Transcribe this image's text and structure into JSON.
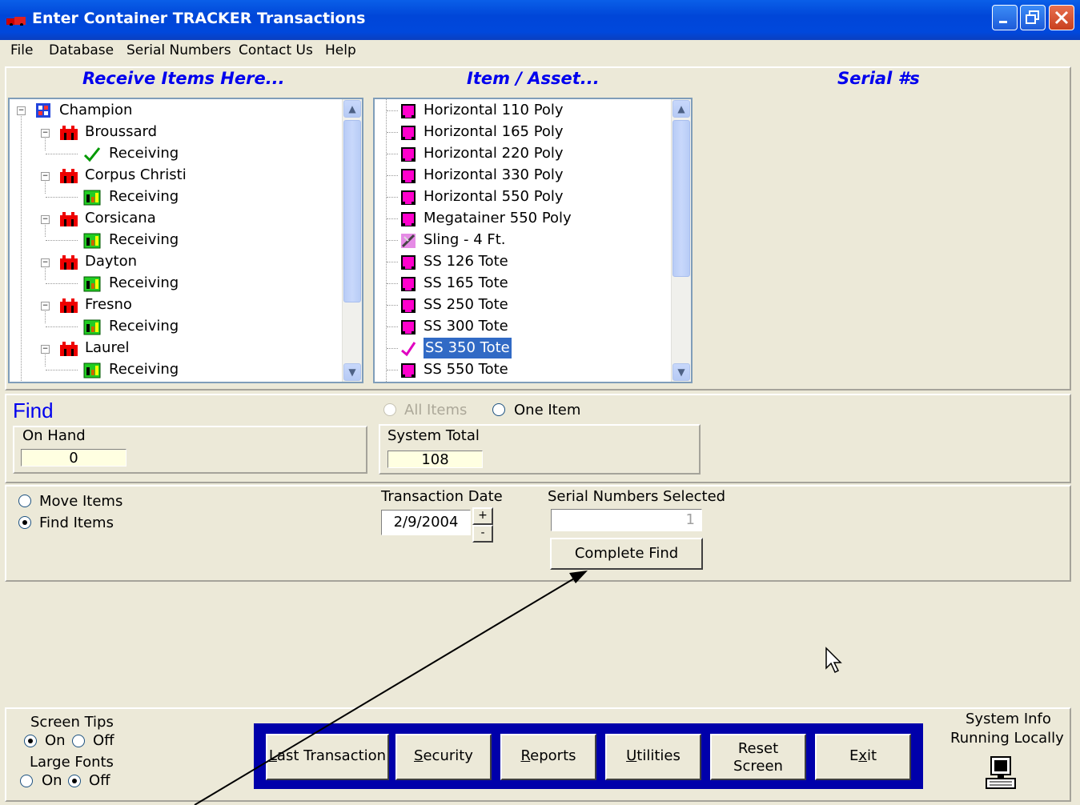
{
  "window": {
    "title": "Enter Container TRACKER Transactions"
  },
  "menu": [
    "File",
    "Database",
    "Serial Numbers",
    "Contact Us",
    "Help"
  ],
  "columns": {
    "receive": "Receive Items Here...",
    "item": "Item / Asset...",
    "serial": "Serial #s"
  },
  "locations": [
    {
      "label": "Champion",
      "level": 0,
      "icon": "network-icon"
    },
    {
      "label": "Broussard",
      "level": 1,
      "icon": "factory-icon"
    },
    {
      "label": "Receiving",
      "level": 2,
      "icon": "checkmark-icon"
    },
    {
      "label": "Corpus Christi",
      "level": 1,
      "icon": "factory-icon"
    },
    {
      "label": "Receiving",
      "level": 2,
      "icon": "receiving-icon"
    },
    {
      "label": "Corsicana",
      "level": 1,
      "icon": "factory-icon"
    },
    {
      "label": "Receiving",
      "level": 2,
      "icon": "receiving-icon"
    },
    {
      "label": "Dayton",
      "level": 1,
      "icon": "factory-icon"
    },
    {
      "label": "Receiving",
      "level": 2,
      "icon": "receiving-icon"
    },
    {
      "label": "Fresno",
      "level": 1,
      "icon": "factory-icon"
    },
    {
      "label": "Receiving",
      "level": 2,
      "icon": "receiving-icon"
    },
    {
      "label": "Laurel",
      "level": 1,
      "icon": "factory-icon"
    },
    {
      "label": "Receiving",
      "level": 2,
      "icon": "receiving-icon"
    }
  ],
  "items": [
    {
      "label": "Horizontal 110 Poly",
      "icon": "tote-icon"
    },
    {
      "label": "Horizontal 165 Poly",
      "icon": "tote-icon"
    },
    {
      "label": "Horizontal 220 Poly",
      "icon": "tote-icon"
    },
    {
      "label": "Horizontal 330 Poly",
      "icon": "tote-icon"
    },
    {
      "label": "Horizontal 550 Poly",
      "icon": "tote-icon"
    },
    {
      "label": "Megatainer 550 Poly",
      "icon": "tote-icon"
    },
    {
      "label": "Sling - 4 Ft.",
      "icon": "sling-icon"
    },
    {
      "label": "SS 126 Tote",
      "icon": "tote-icon"
    },
    {
      "label": "SS 165 Tote",
      "icon": "tote-icon"
    },
    {
      "label": "SS 250 Tote",
      "icon": "tote-icon"
    },
    {
      "label": "SS 300 Tote",
      "icon": "tote-icon"
    },
    {
      "label": "SS 350 Tote",
      "icon": "checkmark-icon",
      "selected": true
    },
    {
      "label": "SS 550 Tote",
      "icon": "tote-icon"
    }
  ],
  "find": {
    "title": "Find",
    "all_items": "All Items",
    "one_item": "One Item",
    "on_hand_label": "On Hand",
    "on_hand_value": "0",
    "system_total_label": "System Total",
    "system_total_value": "108"
  },
  "mode": {
    "move": "Move Items",
    "find": "Find Items",
    "selected": "find"
  },
  "transaction_date": {
    "label": "Transaction Date",
    "value": "2/9/2004",
    "plus": "+",
    "minus": "-"
  },
  "serial_selected": {
    "label": "Serial Numbers Selected",
    "value": "1"
  },
  "complete_find": "Complete Find",
  "screen_tips": {
    "label": "Screen Tips",
    "on": "On",
    "off": "Off",
    "selected": "on"
  },
  "large_fonts": {
    "label": "Large Fonts",
    "on": "On",
    "off": "Off",
    "selected": "off"
  },
  "bottom_buttons": [
    {
      "label": "Last Transaction",
      "hotkey": "L"
    },
    {
      "label": "Security",
      "hotkey": "S"
    },
    {
      "label": "Reports",
      "hotkey": "R"
    },
    {
      "label": "Utilities",
      "hotkey": "U"
    },
    {
      "label": "Reset Screen",
      "hotkey": ""
    },
    {
      "label": "Exit",
      "hotkey": "x"
    }
  ],
  "system_info": {
    "line1": "System Info",
    "line2": "Running Locally"
  },
  "colors": {
    "titlebar": "#0046D8",
    "heading": "#0000EE",
    "button_panel": "#0000AA",
    "selection": "#316AC5",
    "field": "#FFFFE1"
  }
}
